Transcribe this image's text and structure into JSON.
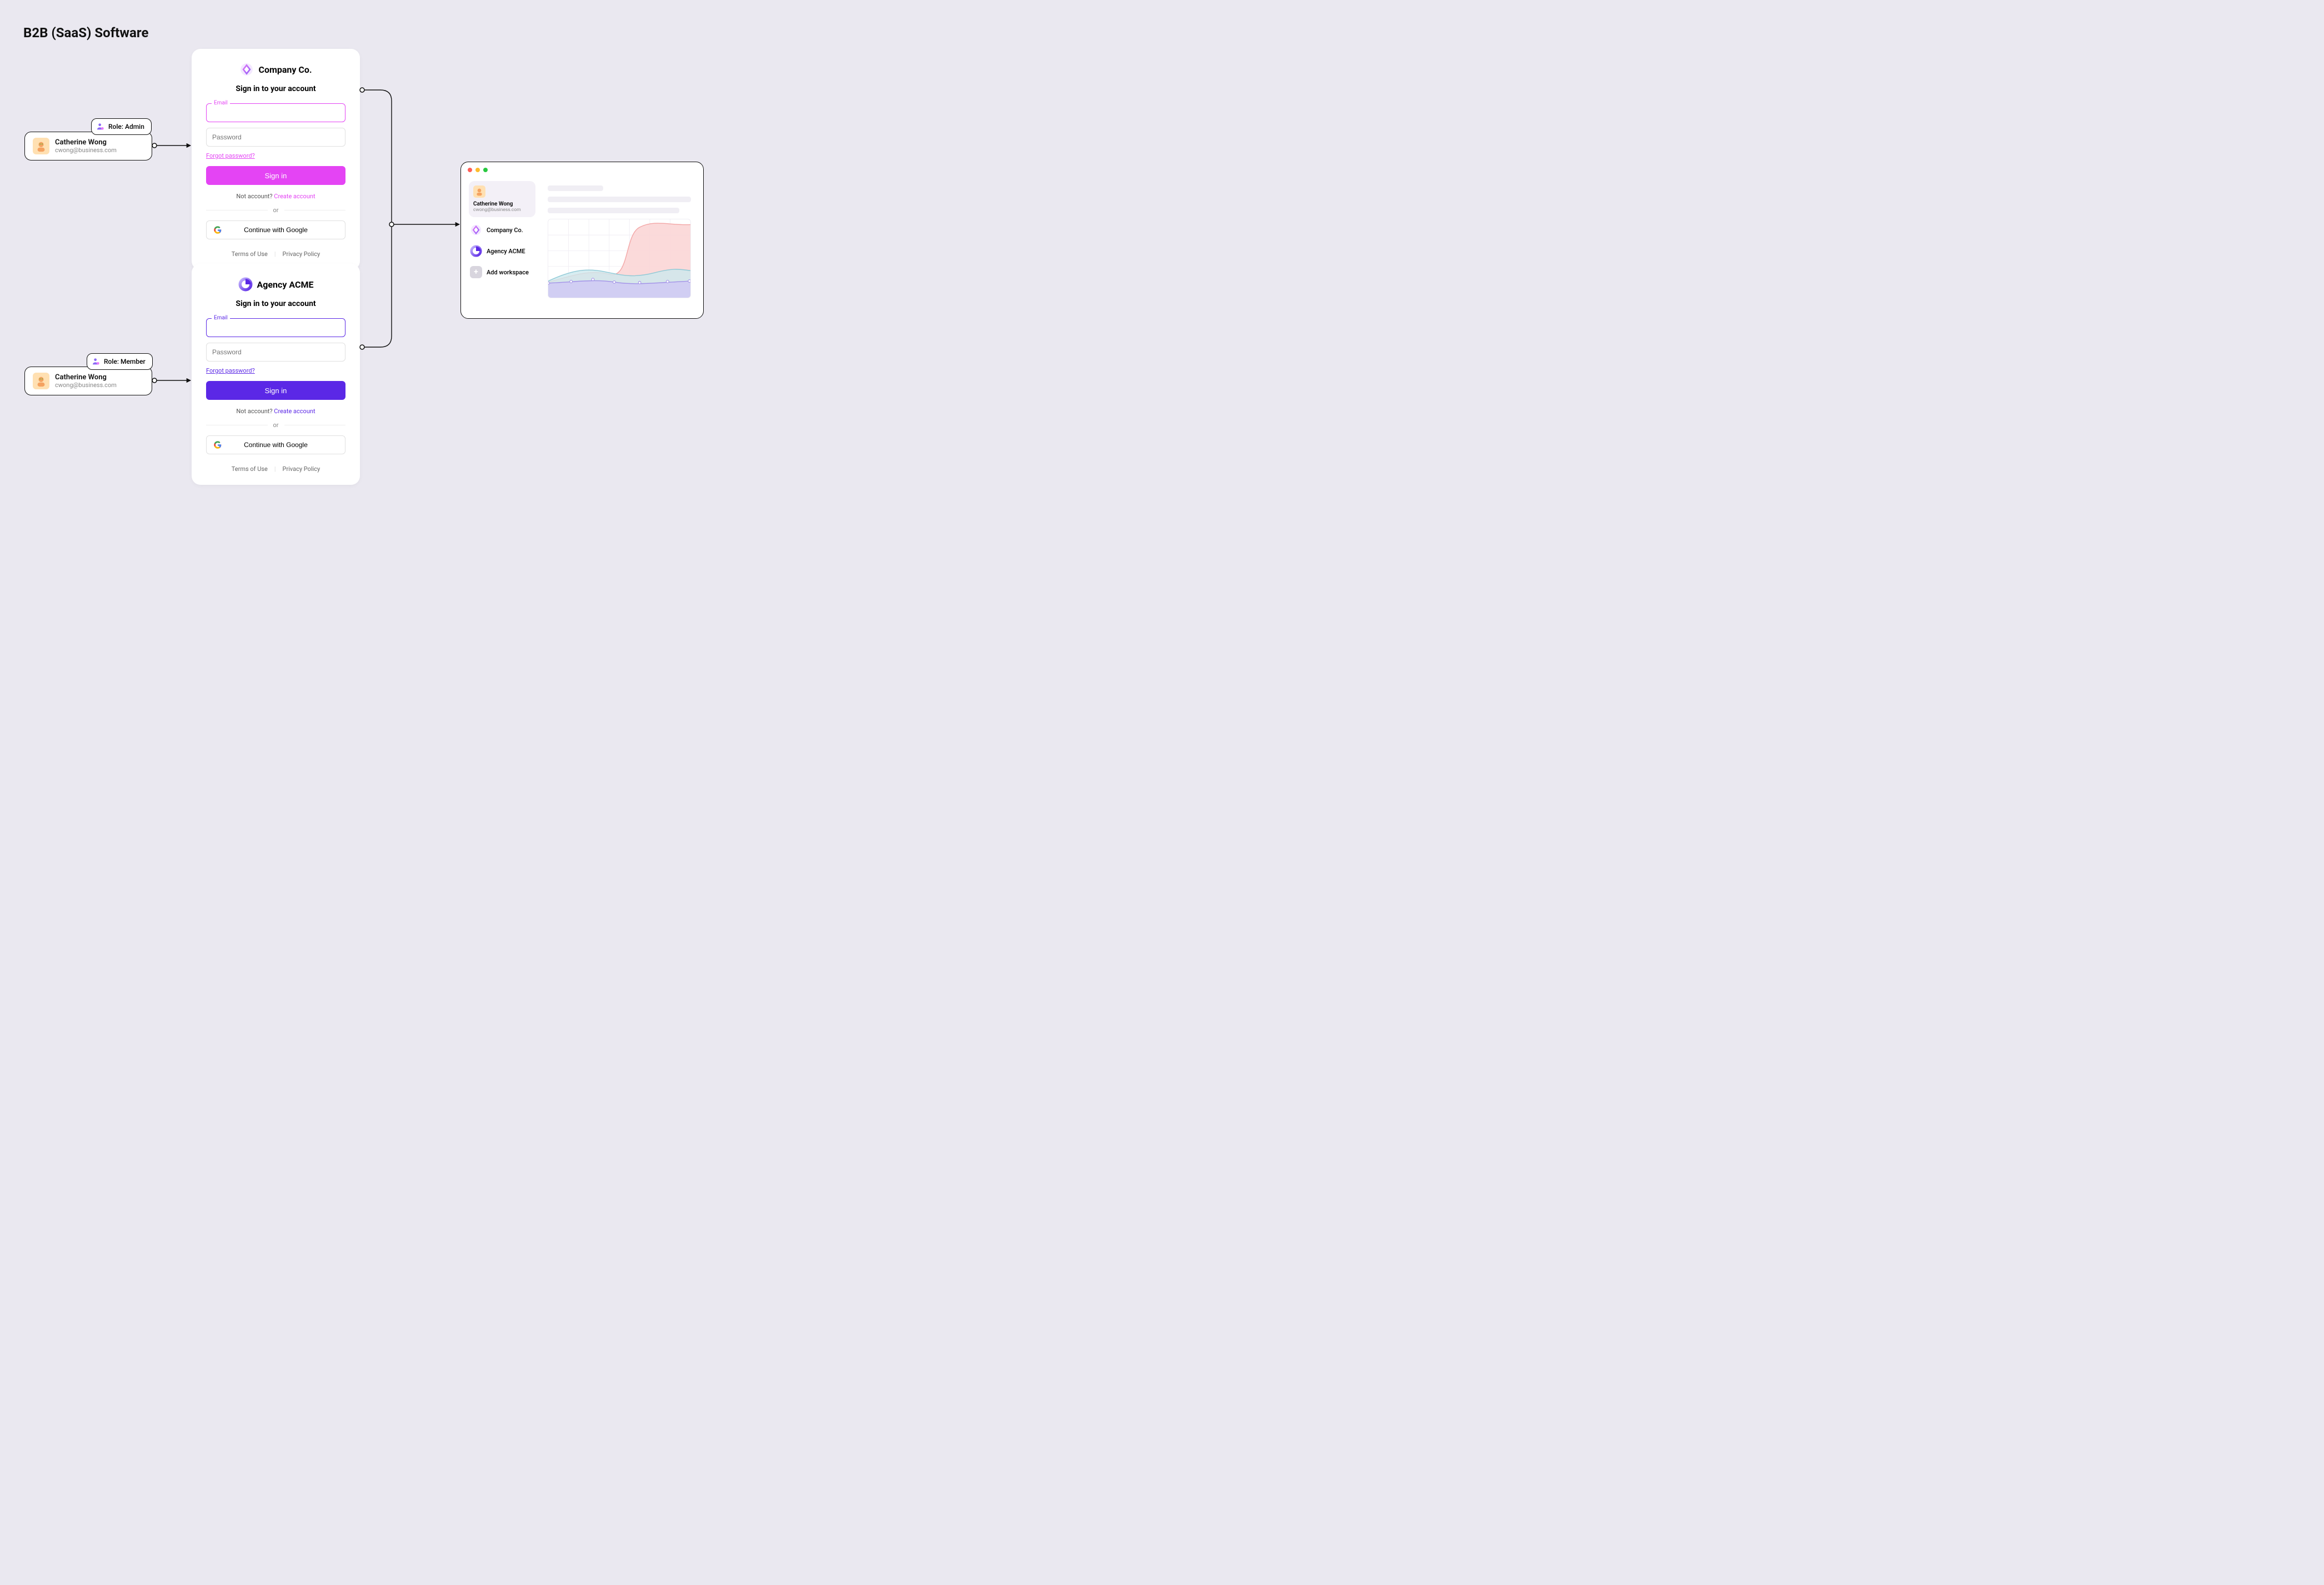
{
  "title": "B2B (SaaS) Software",
  "users": {
    "admin": {
      "name": "Catherine Wong",
      "email": "cwong@business.com",
      "role_label": "Role: Admin"
    },
    "member": {
      "name": "Catherine Wong",
      "email": "cwong@business.com",
      "role_label": "Role: Member"
    }
  },
  "auth_company": {
    "brand_name": "Company Co.",
    "subtitle": "Sign in to your account",
    "email_label": "Email",
    "password_placeholder": "Password",
    "forgot": "Forgot password?",
    "signin": "Sign in",
    "no_account_prefix": "Not account? ",
    "create_account": "Create account",
    "or": "or",
    "google": "Continue with Google",
    "terms": "Terms of Use",
    "privacy": "Privacy Policy",
    "accent": "#E444F4",
    "accent_soft": "#F7A3FF"
  },
  "auth_acme": {
    "brand_name": "Agency ACME",
    "subtitle": "Sign in to your account",
    "email_label": "Email",
    "password_placeholder": "Password",
    "forgot": "Forgot password?",
    "signin": "Sign in",
    "no_account_prefix": "Not account? ",
    "create_account": "Create account",
    "or": "or",
    "google": "Continue with Google",
    "terms": "Terms of Use",
    "privacy": "Privacy Policy",
    "accent": "#5B28E6"
  },
  "dashboard": {
    "user_name": "Catherine Wong",
    "user_email": "cwong@business.com",
    "workspaces": [
      {
        "name": "Company Co."
      },
      {
        "name": "Agency ACME"
      }
    ],
    "add_workspace": "Add workspace"
  }
}
